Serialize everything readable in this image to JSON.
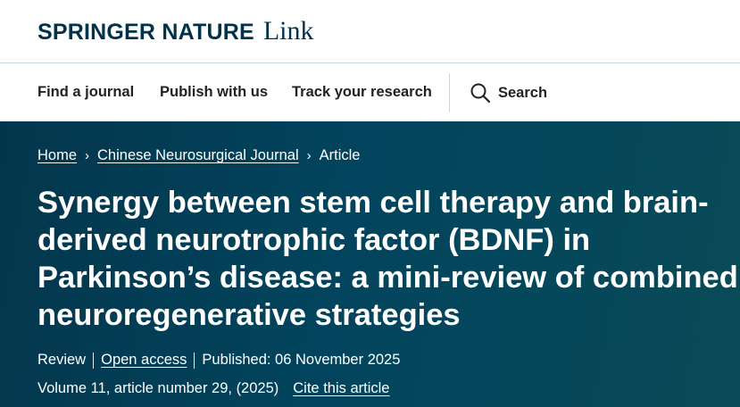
{
  "header": {
    "brand": "SPRINGER NATURE",
    "product": "Link"
  },
  "nav": {
    "items": [
      {
        "label": "Find a journal"
      },
      {
        "label": "Publish with us"
      },
      {
        "label": "Track your research"
      }
    ],
    "search_label": "Search"
  },
  "breadcrumb": {
    "home": "Home",
    "journal": "Chinese Neurosurgical Journal",
    "current": "Article"
  },
  "article": {
    "title": "Synergy between stem cell therapy and brain-derived neurotrophic factor (BDNF) in Parkinson’s disease: a mini-review of combined neuroregenerative strategies",
    "type": "Review",
    "access": "Open access",
    "published": "Published: 06 November 2025",
    "volume_info": "Volume 11, article number 29, (2025)",
    "cite_label": "Cite this article"
  },
  "colors": {
    "brand": "#01324b",
    "hero_bg": "#02445d",
    "text_on_hero": "#ffffff"
  }
}
